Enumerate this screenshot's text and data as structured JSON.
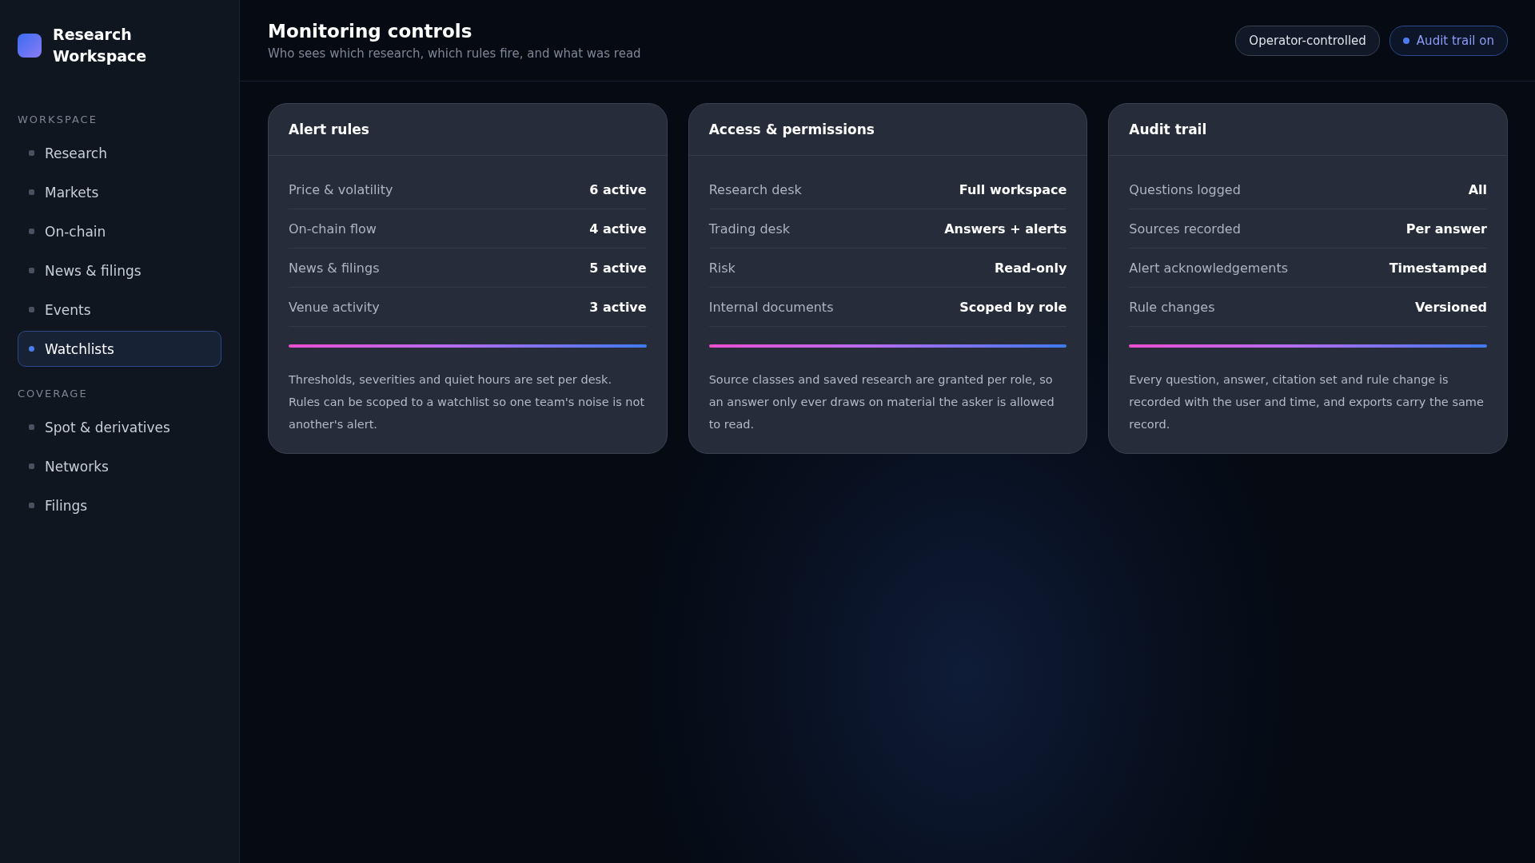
{
  "sidebar": {
    "title": "Research Workspace",
    "sections": [
      {
        "heading": "WORKSPACE",
        "items": [
          {
            "label": "Research",
            "selected": false
          },
          {
            "label": "Markets",
            "selected": false
          },
          {
            "label": "On-chain",
            "selected": false
          },
          {
            "label": "News & filings",
            "selected": false
          },
          {
            "label": "Events",
            "selected": false
          },
          {
            "label": "Watchlists",
            "selected": true
          }
        ]
      },
      {
        "heading": "COVERAGE",
        "items": [
          {
            "label": "Spot & derivatives",
            "selected": false
          },
          {
            "label": "Networks",
            "selected": false
          },
          {
            "label": "Filings",
            "selected": false
          }
        ]
      }
    ]
  },
  "header": {
    "title": "Monitoring controls",
    "subtitle": "Who sees which research, which rules fire, and what was read",
    "badges": [
      {
        "label": "Operator-controlled",
        "kind": "plain"
      },
      {
        "label": "Audit trail on",
        "kind": "status"
      }
    ]
  },
  "cards": [
    {
      "title": "Alert rules",
      "rows": [
        {
          "label": "Price & volatility",
          "value": "6 active"
        },
        {
          "label": "On-chain flow",
          "value": "4 active"
        },
        {
          "label": "News & filings",
          "value": "5 active"
        },
        {
          "label": "Venue activity",
          "value": "3 active"
        }
      ],
      "note": "Thresholds, severities and quiet hours are set per desk. Rules can be scoped to a watchlist so one team's noise is not another's alert."
    },
    {
      "title": "Access & permissions",
      "rows": [
        {
          "label": "Research desk",
          "value": "Full workspace"
        },
        {
          "label": "Trading desk",
          "value": "Answers + alerts"
        },
        {
          "label": "Risk",
          "value": "Read-only"
        },
        {
          "label": "Internal documents",
          "value": "Scoped by role"
        }
      ],
      "note": "Source classes and saved research are granted per role, so an answer only ever draws on material the asker is allowed to read."
    },
    {
      "title": "Audit trail",
      "rows": [
        {
          "label": "Questions logged",
          "value": "All"
        },
        {
          "label": "Sources recorded",
          "value": "Per answer"
        },
        {
          "label": "Alert acknowledgements",
          "value": "Timestamped"
        },
        {
          "label": "Rule changes",
          "value": "Versioned"
        }
      ],
      "note": "Every question, answer, citation set and rule change is recorded with the user and time, and exports carry the same record."
    }
  ]
}
